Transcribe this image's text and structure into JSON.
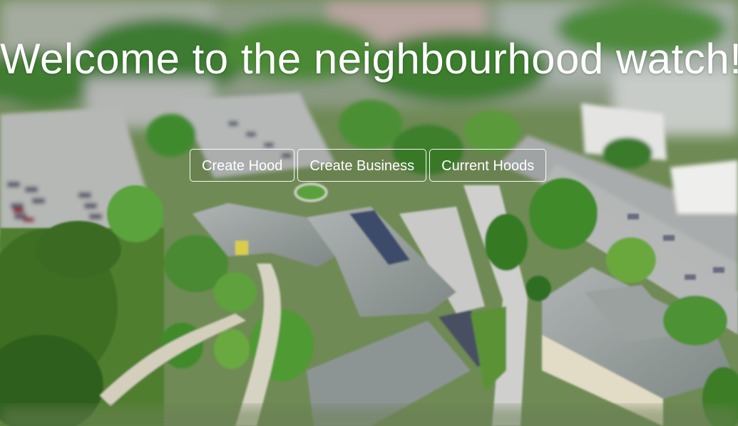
{
  "hero": {
    "title": "Welcome to the neighbourhood watch!"
  },
  "nav": {
    "create_hood": "Create Hood",
    "create_business": "Create Business",
    "current_hoods": "Current Hoods"
  },
  "colors": {
    "text": "#ffffff",
    "button_border": "#ffffff"
  }
}
